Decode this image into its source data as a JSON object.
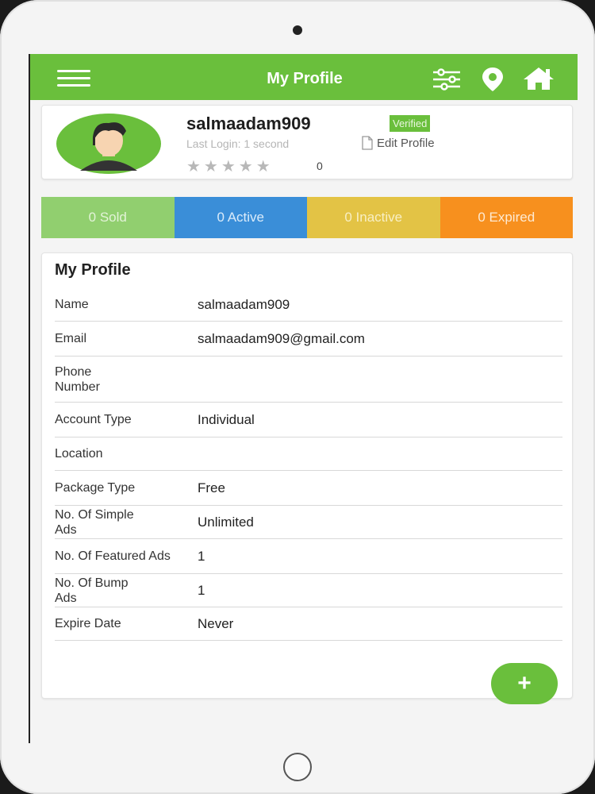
{
  "header": {
    "title": "My Profile",
    "icons": [
      "menu-icon",
      "filter-icon",
      "location-pin-icon",
      "home-icon"
    ],
    "color": "#6abf3c"
  },
  "profile": {
    "username": "salmaadam909",
    "badge": "Verified",
    "last_login": "Last Login: 1 second",
    "edit_label": "Edit Profile",
    "stars": "★★★★★",
    "rating_count": "0"
  },
  "stats": [
    {
      "label": "0 Sold",
      "color": "#91cf6f"
    },
    {
      "label": "0 Active",
      "color": "#3a8ed8"
    },
    {
      "label": "0 Inactive",
      "color": "#e3c345"
    },
    {
      "label": "0 Expired",
      "color": "#f7901e"
    }
  ],
  "details": {
    "title": "My Profile",
    "rows": [
      {
        "label": "Name",
        "value": "salmaadam909"
      },
      {
        "label": "Email",
        "value": "salmaadam909@gmail.com"
      },
      {
        "label": "Phone Number",
        "value": ""
      },
      {
        "label": "Account Type",
        "value": "Individual"
      },
      {
        "label": "Location",
        "value": ""
      },
      {
        "label": "Package Type",
        "value": "Free"
      },
      {
        "label": "No. Of Simple Ads",
        "value": "Unlimited"
      },
      {
        "label": "No. Of Featured Ads",
        "value": "1"
      },
      {
        "label": "No. Of Bump Ads",
        "value": "1"
      },
      {
        "label": "Expire Date",
        "value": "Never"
      }
    ]
  },
  "fab": {
    "label": "+"
  }
}
